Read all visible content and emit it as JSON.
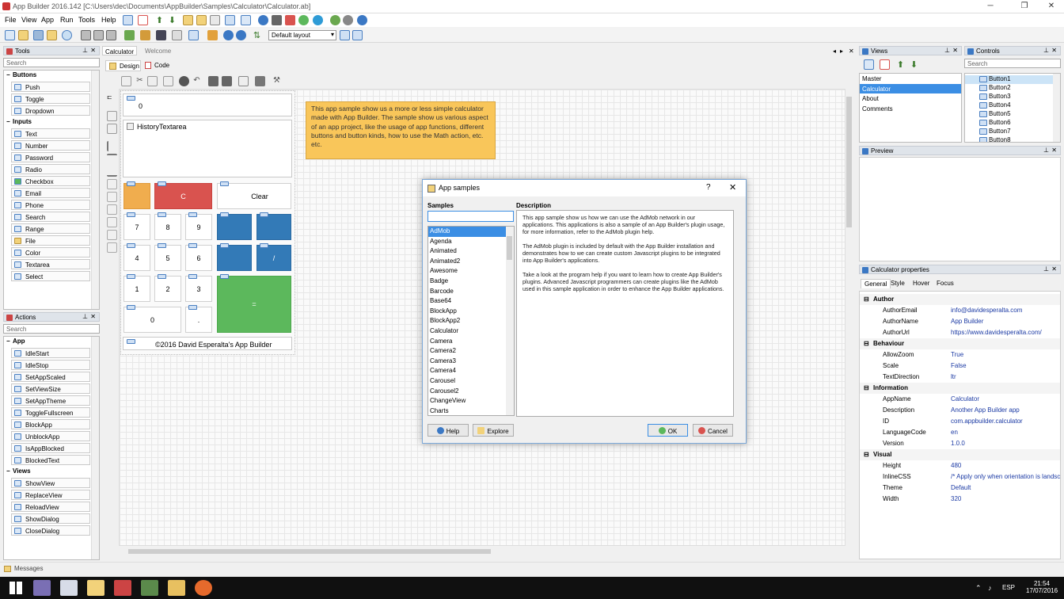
{
  "window": {
    "title": "App Builder 2016.142 [C:\\Users\\dec\\Documents\\AppBuilder\\Samples\\Calculator\\Calculator.ab]"
  },
  "menu": [
    "File",
    "View",
    "App",
    "Run",
    "Tools",
    "Help"
  ],
  "toolbar": {
    "layout_select": "Default layout"
  },
  "tools_panel": {
    "title": "Tools",
    "search_placeholder": "Search",
    "groups": [
      {
        "name": "Buttons",
        "items": [
          "Push",
          "Toggle",
          "Dropdown"
        ]
      },
      {
        "name": "Inputs",
        "items": [
          "Text",
          "Number",
          "Password",
          "Radio",
          "Checkbox",
          "Email",
          "Phone",
          "Search",
          "Range",
          "File",
          "Color",
          "Textarea",
          "Select"
        ]
      }
    ]
  },
  "actions_panel": {
    "title": "Actions",
    "search_placeholder": "Search",
    "groups": [
      {
        "name": "App",
        "items": [
          "IdleStart",
          "IdleStop",
          "SetAppScaled",
          "SetViewSize",
          "SetAppTheme",
          "ToggleFullscreen",
          "BlockApp",
          "UnblockApp",
          "IsAppBlocked",
          "BlockedText"
        ]
      },
      {
        "name": "Views",
        "items": [
          "ShowView",
          "ReplaceView",
          "ReloadView",
          "ShowDialog",
          "CloseDialog"
        ]
      }
    ]
  },
  "doc_tabs": [
    "Calculator",
    "Welcome"
  ],
  "subtabs": [
    "Design",
    "Code"
  ],
  "calculator": {
    "display": "0",
    "history": "HistoryTextarea",
    "keys": {
      "c": "C",
      "clear": "Clear",
      "k7": "7",
      "k8": "8",
      "k9": "9",
      "k4": "4",
      "k5": "5",
      "k6": "6",
      "div": "/",
      "k1": "1",
      "k2": "2",
      "k3": "3",
      "eq": "=",
      "k0": "0",
      "dot": "."
    },
    "footer": "©2016 David Esperalta's App Builder",
    "colors": {
      "orange": "#f0ad4e",
      "red": "#d9534f",
      "blue": "#337ab7",
      "green": "#5cb85c"
    }
  },
  "note": "This app sample show us a more or less simple calculator made with App Builder. The sample show us various aspect of an app project, like the usage of app functions, different buttons and button kinds, how to use the Math action, etc. etc.",
  "dialog": {
    "title": "App samples",
    "help_mark": "?",
    "close": "✕",
    "samples_label": "Samples",
    "description_label": "Description",
    "samples": [
      "AdMob",
      "Agenda",
      "Animated",
      "Animated2",
      "Awesome",
      "Badge",
      "Barcode",
      "Base64",
      "BlockApp",
      "BlockApp2",
      "Calculator",
      "Camera",
      "Camera2",
      "Camera3",
      "Camera4",
      "Carousel",
      "Carousel2",
      "ChangeView",
      "Charts"
    ],
    "selected": "AdMob",
    "description": [
      "This app sample show us how we can use the AdMob network in our applications. This applications is also a sample of an App Builder's plugin usage, for more information, refer to the AdMob plugin help.",
      "The AdMob plugin is included by default with the App Builder installation and demonstrates how to we can create custom Javascript plugins to be integrated into App Builder's applications.",
      "Take a look at the program help if you want to learn how to create App Builder's plugins. Advanced Javascript programmers can create plugins like the AdMob used in this sample application in order to enhance the App Builder applications."
    ],
    "buttons": {
      "help": "Help",
      "explore": "Explore",
      "ok": "OK",
      "cancel": "Cancel"
    }
  },
  "views_panel": {
    "title": "Views",
    "items": [
      "Master",
      "Calculator",
      "About",
      "Comments"
    ],
    "selected": "Calculator"
  },
  "controls_panel": {
    "title": "Controls",
    "search_placeholder": "Search",
    "items": [
      "Button1",
      "Button2",
      "Button3",
      "Button4",
      "Button5",
      "Button6",
      "Button7",
      "Button8"
    ]
  },
  "preview_panel": {
    "title": "Preview"
  },
  "properties_panel": {
    "title": "Calculator properties",
    "tabs": [
      "General",
      "Style",
      "Hover",
      "Focus"
    ],
    "groups": [
      {
        "name": "Author",
        "rows": [
          [
            "AuthorEmail",
            "info@davidesperalta.com"
          ],
          [
            "AuthorName",
            "App Builder"
          ],
          [
            "AuthorUrl",
            "https://www.davidesperalta.com/"
          ]
        ]
      },
      {
        "name": "Behaviour",
        "rows": [
          [
            "AllowZoom",
            "True"
          ],
          [
            "Scale",
            "False"
          ],
          [
            "TextDirection",
            "ltr"
          ]
        ]
      },
      {
        "name": "Information",
        "rows": [
          [
            "AppName",
            "Calculator"
          ],
          [
            "Description",
            "Another App Builder app"
          ],
          [
            "ID",
            "com.appbuilder.calculator"
          ],
          [
            "LanguageCode",
            "en"
          ],
          [
            "Version",
            "1.0.0"
          ]
        ]
      },
      {
        "name": "Visual",
        "rows": [
          [
            "Height",
            "480"
          ],
          [
            "InlineCSS",
            "/* Apply only when orientation is landsca"
          ],
          [
            "Theme",
            "Default"
          ],
          [
            "Width",
            "320"
          ]
        ]
      }
    ]
  },
  "messages_panel": {
    "title": "Messages"
  },
  "taskbar": {
    "lang": "ESP",
    "time": "21:54",
    "date": "17/07/2016"
  }
}
